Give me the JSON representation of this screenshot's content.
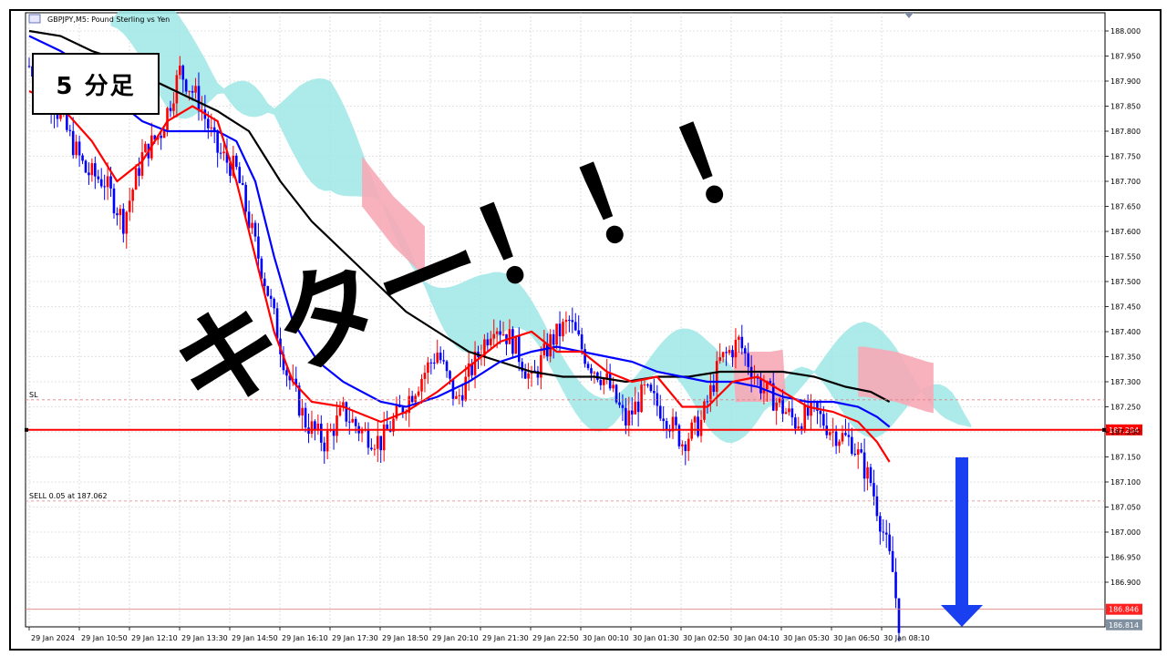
{
  "header": {
    "title": "GBPJPY,M5:  Pound Sterling vs Yen",
    "label_box": "5 分足"
  },
  "annotations": {
    "main_text": "キター！！！"
  },
  "levels": {
    "sl_label": "SL",
    "sell_label": "SELL 0.05 at 187.062",
    "red_line_value": "187.204",
    "tag_red": "186.846",
    "tag_gray": "186.814"
  },
  "colors": {
    "bull": "#ff0000",
    "bear": "#0000ff",
    "cloud_bull": "#9fe6e6",
    "cloud_bear": "#f7aab6",
    "ma_fast": "#ff0000",
    "ma_mid": "#0000ff",
    "ma_slow": "#000000",
    "level_line": "#ff0000",
    "arrow": "#1a3ff0"
  },
  "chart_data": {
    "type": "candlestick",
    "symbol": "GBPJPY",
    "timeframe": "M5",
    "title": "GBPJPY,M5:  Pound Sterling vs Yen",
    "ylim": [
      186.76,
      188.02
    ],
    "y_ticks": [
      "188.000",
      "187.950",
      "187.900",
      "187.850",
      "187.800",
      "187.750",
      "187.700",
      "187.650",
      "187.600",
      "187.550",
      "187.500",
      "187.450",
      "187.400",
      "187.350",
      "187.300",
      "187.250",
      "187.200",
      "187.150",
      "187.100",
      "187.050",
      "187.000",
      "186.950",
      "186.900"
    ],
    "x_labels": [
      "29 Jan 2024",
      "29 Jan 10:50",
      "29 Jan 12:10",
      "29 Jan 13:30",
      "29 Jan 14:50",
      "29 Jan 16:10",
      "29 Jan 17:30",
      "29 Jan 18:50",
      "29 Jan 20:10",
      "29 Jan 21:30",
      "29 Jan 22:50",
      "30 Jan 00:10",
      "30 Jan 01:30",
      "30 Jan 02:50",
      "30 Jan 04:10",
      "30 Jan 05:30",
      "30 Jan 06:50",
      "30 Jan 08:10"
    ],
    "horizontal_lines": [
      {
        "name": "SL",
        "value": 187.264
      },
      {
        "name": "SELL 0.05 at 187.062",
        "value": 187.062
      },
      {
        "name": "level",
        "value": 187.204
      },
      {
        "name": "bid",
        "value": 186.846
      }
    ],
    "price_path": [
      {
        "i": 0,
        "p": 187.93
      },
      {
        "i": 6,
        "p": 187.88
      },
      {
        "i": 12,
        "p": 187.8
      },
      {
        "i": 18,
        "p": 187.72
      },
      {
        "i": 24,
        "p": 187.7
      },
      {
        "i": 30,
        "p": 187.62
      },
      {
        "i": 36,
        "p": 187.75
      },
      {
        "i": 42,
        "p": 187.8
      },
      {
        "i": 48,
        "p": 187.92
      },
      {
        "i": 54,
        "p": 187.86
      },
      {
        "i": 60,
        "p": 187.76
      },
      {
        "i": 66,
        "p": 187.72
      },
      {
        "i": 70,
        "p": 187.62
      },
      {
        "i": 76,
        "p": 187.48
      },
      {
        "i": 82,
        "p": 187.32
      },
      {
        "i": 88,
        "p": 187.22
      },
      {
        "i": 94,
        "p": 187.18
      },
      {
        "i": 100,
        "p": 187.24
      },
      {
        "i": 106,
        "p": 187.2
      },
      {
        "i": 112,
        "p": 187.18
      },
      {
        "i": 118,
        "p": 187.24
      },
      {
        "i": 124,
        "p": 187.3
      },
      {
        "i": 130,
        "p": 187.36
      },
      {
        "i": 136,
        "p": 187.26
      },
      {
        "i": 142,
        "p": 187.34
      },
      {
        "i": 148,
        "p": 187.42
      },
      {
        "i": 154,
        "p": 187.38
      },
      {
        "i": 160,
        "p": 187.3
      },
      {
        "i": 166,
        "p": 187.38
      },
      {
        "i": 172,
        "p": 187.42
      },
      {
        "i": 178,
        "p": 187.34
      },
      {
        "i": 184,
        "p": 187.3
      },
      {
        "i": 190,
        "p": 187.22
      },
      {
        "i": 196,
        "p": 187.28
      },
      {
        "i": 202,
        "p": 187.24
      },
      {
        "i": 208,
        "p": 187.18
      },
      {
        "i": 214,
        "p": 187.22
      },
      {
        "i": 220,
        "p": 187.34
      },
      {
        "i": 226,
        "p": 187.38
      },
      {
        "i": 232,
        "p": 187.3
      },
      {
        "i": 238,
        "p": 187.26
      },
      {
        "i": 244,
        "p": 187.22
      },
      {
        "i": 250,
        "p": 187.24
      },
      {
        "i": 256,
        "p": 187.2
      },
      {
        "i": 262,
        "p": 187.18
      },
      {
        "i": 268,
        "p": 187.1
      },
      {
        "i": 272,
        "p": 187.0
      },
      {
        "i": 275,
        "p": 186.92
      },
      {
        "i": 277,
        "p": 186.82
      }
    ],
    "ma_fast": [
      [
        0,
        187.88
      ],
      [
        10,
        187.85
      ],
      [
        20,
        187.78
      ],
      [
        28,
        187.7
      ],
      [
        36,
        187.74
      ],
      [
        44,
        187.82
      ],
      [
        52,
        187.85
      ],
      [
        60,
        187.82
      ],
      [
        66,
        187.7
      ],
      [
        72,
        187.55
      ],
      [
        78,
        187.4
      ],
      [
        84,
        187.3
      ],
      [
        90,
        187.26
      ],
      [
        100,
        187.25
      ],
      [
        112,
        187.22
      ],
      [
        120,
        187.24
      ],
      [
        130,
        187.28
      ],
      [
        140,
        187.33
      ],
      [
        150,
        187.38
      ],
      [
        160,
        187.4
      ],
      [
        168,
        187.36
      ],
      [
        176,
        187.36
      ],
      [
        184,
        187.32
      ],
      [
        192,
        187.3
      ],
      [
        200,
        187.31
      ],
      [
        208,
        187.25
      ],
      [
        216,
        187.25
      ],
      [
        224,
        187.3
      ],
      [
        232,
        187.31
      ],
      [
        240,
        187.28
      ],
      [
        248,
        187.25
      ],
      [
        256,
        187.24
      ],
      [
        264,
        187.22
      ],
      [
        270,
        187.18
      ],
      [
        274,
        187.14
      ]
    ],
    "ma_mid": [
      [
        0,
        187.99
      ],
      [
        10,
        187.96
      ],
      [
        20,
        187.92
      ],
      [
        28,
        187.86
      ],
      [
        36,
        187.82
      ],
      [
        44,
        187.8
      ],
      [
        52,
        187.8
      ],
      [
        60,
        187.8
      ],
      [
        66,
        187.78
      ],
      [
        72,
        187.7
      ],
      [
        78,
        187.55
      ],
      [
        84,
        187.42
      ],
      [
        92,
        187.34
      ],
      [
        100,
        187.3
      ],
      [
        112,
        187.26
      ],
      [
        120,
        187.25
      ],
      [
        130,
        187.27
      ],
      [
        140,
        187.3
      ],
      [
        150,
        187.34
      ],
      [
        160,
        187.36
      ],
      [
        168,
        187.37
      ],
      [
        176,
        187.36
      ],
      [
        184,
        187.35
      ],
      [
        192,
        187.34
      ],
      [
        200,
        187.32
      ],
      [
        208,
        187.31
      ],
      [
        216,
        187.3
      ],
      [
        224,
        187.3
      ],
      [
        232,
        187.29
      ],
      [
        240,
        187.27
      ],
      [
        248,
        187.26
      ],
      [
        256,
        187.26
      ],
      [
        264,
        187.25
      ],
      [
        270,
        187.23
      ],
      [
        274,
        187.21
      ]
    ],
    "ma_slow": [
      [
        0,
        188.0
      ],
      [
        10,
        187.99
      ],
      [
        20,
        187.96
      ],
      [
        30,
        187.94
      ],
      [
        40,
        187.9
      ],
      [
        50,
        187.87
      ],
      [
        60,
        187.84
      ],
      [
        70,
        187.8
      ],
      [
        80,
        187.7
      ],
      [
        90,
        187.62
      ],
      [
        100,
        187.56
      ],
      [
        110,
        187.5
      ],
      [
        120,
        187.44
      ],
      [
        130,
        187.4
      ],
      [
        140,
        187.36
      ],
      [
        150,
        187.34
      ],
      [
        160,
        187.32
      ],
      [
        170,
        187.31
      ],
      [
        180,
        187.31
      ],
      [
        190,
        187.3
      ],
      [
        200,
        187.31
      ],
      [
        210,
        187.31
      ],
      [
        220,
        187.32
      ],
      [
        230,
        187.32
      ],
      [
        240,
        187.32
      ],
      [
        250,
        187.31
      ],
      [
        260,
        187.29
      ],
      [
        268,
        187.28
      ],
      [
        274,
        187.26
      ]
    ]
  }
}
